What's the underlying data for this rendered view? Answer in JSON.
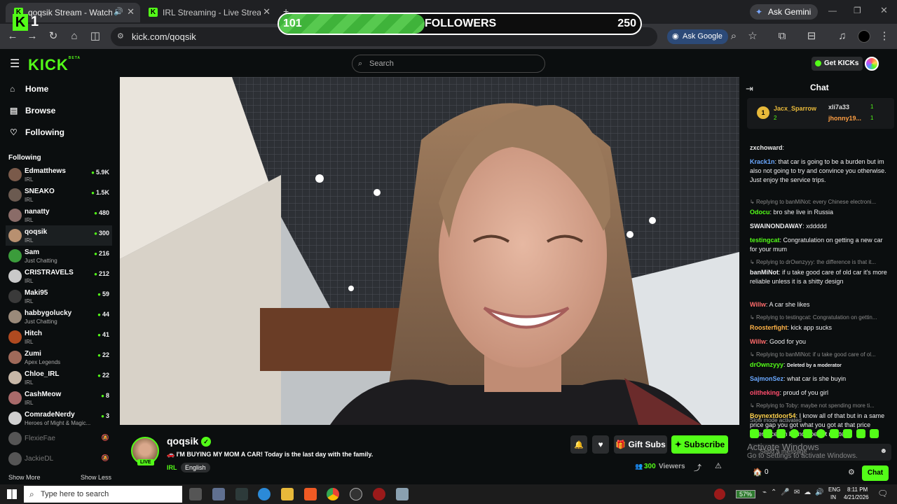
{
  "browser": {
    "tabs": [
      {
        "label": "qoqsik Stream - Watch Live on Kick",
        "active": true
      },
      {
        "label": "IRL Streaming - Live Streams on Kick",
        "active": false
      }
    ],
    "url": "kick.com/qoqsik",
    "ask_google": "Ask Google",
    "ask_gemini": "Ask Gemini"
  },
  "overlay": {
    "logo_number": "1",
    "followers_current": "101",
    "followers_label": "FOLLOWERS",
    "followers_goal": "250",
    "progress_fraction": 0.404
  },
  "header": {
    "logo": "KICK",
    "logo_sup": "BETA",
    "search_placeholder": "Search",
    "get_kicks": "Get KICKs"
  },
  "sidebar": {
    "nav": [
      {
        "label": "Home",
        "icon": "home-icon"
      },
      {
        "label": "Browse",
        "icon": "browse-icon"
      },
      {
        "label": "Following",
        "icon": "heart-icon"
      }
    ],
    "following_title": "Following",
    "channels": [
      {
        "name": "Edmatthews",
        "category": "IRL",
        "viewers": "5.9K",
        "color": "#7a5a4a"
      },
      {
        "name": "SNEAKO",
        "category": "IRL",
        "viewers": "1.5K",
        "color": "#6b5a50"
      },
      {
        "name": "nanatty",
        "category": "IRL",
        "viewers": "480",
        "color": "#8a6c68"
      },
      {
        "name": "qoqsik",
        "category": "IRL",
        "viewers": "300",
        "color": "#b89070"
      },
      {
        "name": "Sam",
        "category": "Just Chatting",
        "viewers": "216",
        "color": "#3b9c3b"
      },
      {
        "name": "CRISTRAVELS",
        "category": "IRL",
        "viewers": "212",
        "color": "#c9c9c9"
      },
      {
        "name": "Maki95",
        "category": "IRL",
        "viewers": "59",
        "color": "#3a3a3a"
      },
      {
        "name": "habbygolucky",
        "category": "Just Chatting",
        "viewers": "44",
        "color": "#9a8a7a"
      },
      {
        "name": "Hitch",
        "category": "IRL",
        "viewers": "41",
        "color": "#b04a20"
      },
      {
        "name": "Zumi",
        "category": "Apex Legends",
        "viewers": "22",
        "color": "#a06a5a"
      },
      {
        "name": "Chloe_IRL",
        "category": "IRL",
        "viewers": "22",
        "color": "#c8b8a8"
      },
      {
        "name": "CashMeow",
        "category": "IRL",
        "viewers": "8",
        "color": "#a86a6a"
      },
      {
        "name": "ComradeNerdy",
        "category": "Heroes of Might & Magic...",
        "viewers": "3",
        "color": "#d0d0d0"
      }
    ],
    "offline": [
      {
        "name": "FlexieFae",
        "color": "#555"
      },
      {
        "name": "JackieDL",
        "color": "#555"
      }
    ],
    "show_more": "Show More",
    "show_less": "Show Less"
  },
  "stream": {
    "channel": "qoqsik",
    "live_badge": "LIVE",
    "title": "🚗 I'M BUYING MY MOM A CAR! Today is the last day with the family.",
    "category": "IRL",
    "language": "English",
    "gift_subs": "Gift Subs",
    "subscribe": "Subscribe",
    "viewers_count": "300",
    "viewers_label": "Viewers"
  },
  "chat": {
    "title": "Chat",
    "leaderboard": [
      {
        "rank": "1",
        "name": "Jacx_Sparrow",
        "count": "2"
      },
      {
        "name": "xli7a33",
        "count": "1"
      },
      {
        "name": "jhonny19...",
        "count": "1"
      }
    ],
    "messages": [
      {
        "type": "msg",
        "user": "zxchoward",
        "color": "#e8e8e8",
        "text": ""
      },
      {
        "type": "msg",
        "user": "Krack1n",
        "color": "#6aa8ff",
        "text": "that car is going to be a burden but im also not going to try and convince you otherwise. Just enjoy the service trips."
      },
      {
        "type": "reply",
        "text": "Replying to banMiNot: every Chinese electroni..."
      },
      {
        "type": "msg",
        "user": "Odocu",
        "color": "#53fc18",
        "text": "bro she live in Russia"
      },
      {
        "type": "msg",
        "user": "SWAINONDAWAY",
        "color": "#efeff1",
        "text": "xddddd"
      },
      {
        "type": "msg",
        "user": "testingcat",
        "color": "#53fc18",
        "text": "Congratulation on getting a new car for your mum"
      },
      {
        "type": "reply",
        "text": "Replying to drOwnzyyy: the difference is that it..."
      },
      {
        "type": "msg",
        "user": "banMiNot",
        "color": "#efeff1",
        "text": "if u take good care of old car it's more reliable unless it is a shitty design"
      },
      {
        "type": "msg",
        "user": "Willw",
        "color": "#ff6b6b",
        "text": "A car she likes"
      },
      {
        "type": "reply",
        "text": "Replying to testingcat: Congratulation on gettin..."
      },
      {
        "type": "msg",
        "user": "Roosterfight",
        "color": "#ffb347",
        "text": "kick app sucks"
      },
      {
        "type": "msg",
        "user": "Willw",
        "color": "#ff6b6b",
        "text": "Good for you"
      },
      {
        "type": "reply",
        "text": "Replying to banMiNot: if u take good care of ol..."
      },
      {
        "type": "msg",
        "user": "drOwnzyyy",
        "color": "#53fc18",
        "text": "Deleted by a moderator"
      },
      {
        "type": "msg",
        "user": "SajmonSez",
        "color": "#6aa8ff",
        "text": "what car is she buyin"
      },
      {
        "type": "msg",
        "user": "oiitheking",
        "color": "#ff4d6d",
        "text": "proud of you girl"
      },
      {
        "type": "reply",
        "text": "Replying to Toby: maybe not spending more ti..."
      },
      {
        "type": "msg",
        "user": "Boynextdoor54",
        "color": "#ffd24d",
        "text": "I know all of that but in a same price gap you got what you got at that price differences in brand doesn't matter"
      }
    ],
    "slow_mode": "Slow mode activated",
    "send_placeholder": "Send a message",
    "kicks_count": "0",
    "chat_button": "Chat",
    "watermark_title": "Activate Windows",
    "watermark_sub": "Go to Settings to activate Windows."
  },
  "taskbar": {
    "search_placeholder": "Type here to search",
    "battery": "57%",
    "lang_top": "ENG",
    "lang_bottom": "IN",
    "time": "8:11 PM",
    "date": "4/21/2026"
  }
}
